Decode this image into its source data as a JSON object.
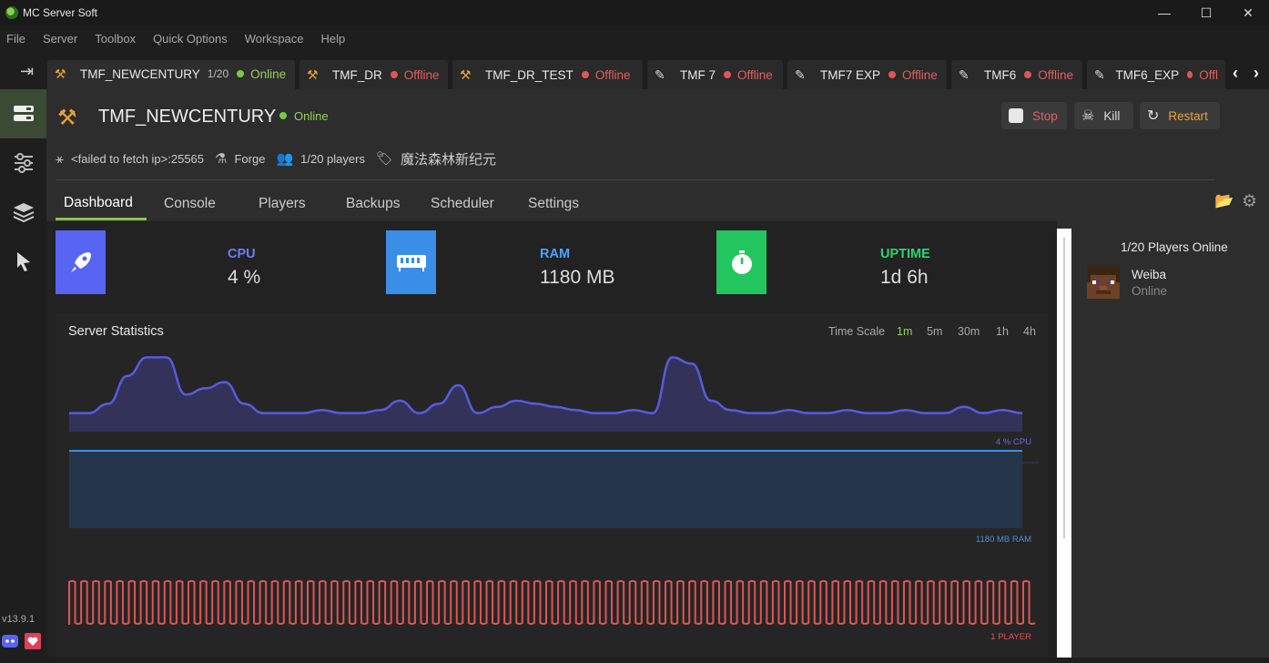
{
  "window": {
    "title": "MC Server Soft",
    "controls": {
      "minimize": "—",
      "maximize": "☐",
      "close": "✕"
    }
  },
  "menu": [
    "File",
    "Server",
    "Toolbox",
    "Quick Options",
    "Workspace",
    "Help"
  ],
  "tabs": [
    {
      "name": "TMF_NEWCENTURY",
      "count": "1/20",
      "status": "Online",
      "active": true,
      "icon": "anvil-icon"
    },
    {
      "name": "TMF_DR",
      "status": "Offline",
      "icon": "anvil-icon"
    },
    {
      "name": "TMF_DR_TEST",
      "status": "Offline",
      "icon": "anvil-icon"
    },
    {
      "name": "TMF 7",
      "status": "Offline",
      "icon": "scroll-icon"
    },
    {
      "name": "TMF7 EXP",
      "status": "Offline",
      "icon": "scroll-icon"
    },
    {
      "name": "TMF6",
      "status": "Offline",
      "icon": "scroll-icon"
    },
    {
      "name": "TMF6_EXP",
      "status": "Offl",
      "icon": "scroll-icon"
    }
  ],
  "server": {
    "name": "TMF_NEWCENTURY",
    "status": "Online",
    "ip": "<failed to fetch ip>:25565",
    "loader": "Forge",
    "players": "1/20 players",
    "tag": "魔法森林新纪元"
  },
  "actions": {
    "stop": "Stop",
    "kill": "Kill",
    "restart": "Restart"
  },
  "subtabs": [
    "Dashboard",
    "Console",
    "Players",
    "Backups",
    "Scheduler",
    "Settings"
  ],
  "cards": {
    "cpu": {
      "label": "CPU",
      "value": "4 %",
      "color": "#5865f2"
    },
    "ram": {
      "label": "RAM",
      "value": "1180 MB",
      "color": "#3a8ee6"
    },
    "uptime": {
      "label": "UPTIME",
      "value": "1d 6h",
      "color": "#22c55e"
    }
  },
  "stats": {
    "title": "Server Statistics",
    "time_scale_label": "Time Scale",
    "scales": [
      "1m",
      "5m",
      "30m",
      "1h",
      "4h"
    ],
    "active_scale": "1m",
    "cpu_label": "4 % CPU",
    "ram_label": "1180 MB RAM",
    "player_label": "1 PLAYER"
  },
  "chart_data": [
    {
      "type": "area",
      "series": [
        {
          "name": "CPU",
          "values": [
            6,
            6,
            9,
            18,
            24,
            24,
            12,
            14,
            16,
            9,
            6,
            6,
            6,
            7,
            6,
            6,
            7,
            10,
            6,
            9,
            15,
            6,
            8,
            10,
            9,
            8,
            7,
            6,
            6,
            7,
            6,
            24,
            22,
            10,
            7,
            6,
            6,
            7,
            6,
            6,
            7,
            6,
            6,
            7,
            6,
            6,
            8,
            6,
            7,
            6
          ]
        }
      ]
    },
    {
      "type": "area",
      "series": [
        {
          "name": "RAM",
          "values": [
            1180,
            1180
          ]
        }
      ]
    },
    {
      "type": "line",
      "series": [
        {
          "name": "Players",
          "values": [
            1,
            1
          ]
        }
      ]
    }
  ],
  "players_panel": {
    "title": "1/20 Players Online",
    "players": [
      {
        "name": "Weiba",
        "status": "Online"
      }
    ]
  },
  "sidebar": {
    "version": "v13.9.1"
  }
}
